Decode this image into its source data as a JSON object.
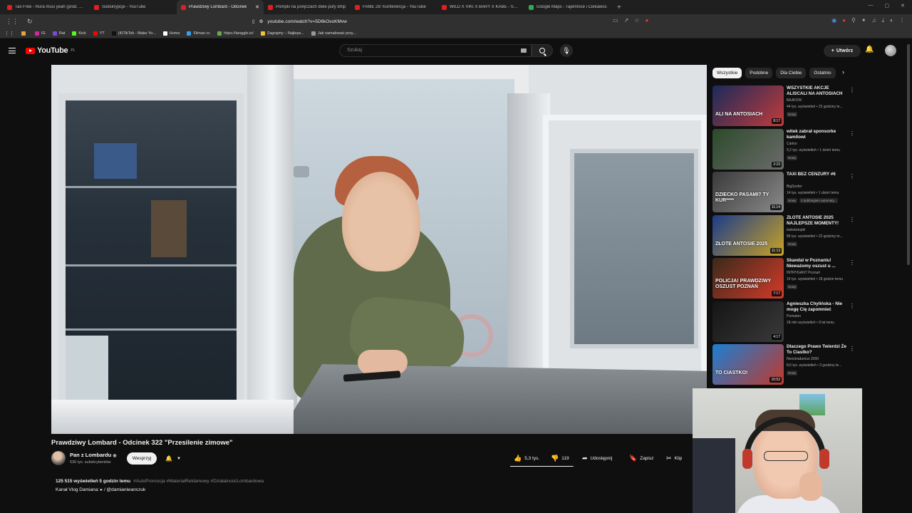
{
  "browser": {
    "tabs": [
      {
        "label": "Tax Free - Rura musi yeah (prod. CLO",
        "favicon": "youtube-favicon",
        "active": false
      },
      {
        "label": "Subskrypcje - YouTube",
        "favicon": "youtube-favicon",
        "active": false
      },
      {
        "label": "Prawdziwy Lombard - Odcinek",
        "favicon": "youtube-favicon",
        "active": true
      },
      {
        "label": "Pompki na poręczach dwie pufy dmp",
        "favicon": "youtube-favicon",
        "active": false
      },
      {
        "label": "FAME 29: Konferencja - YouTube",
        "favicon": "youtube-favicon",
        "active": false
      },
      {
        "label": "WILD X VIKI X BARY X KABE - SZLAG",
        "favicon": "youtube-favicon",
        "active": false
      },
      {
        "label": "Google Maps - Tajemnice i Ciekawos",
        "favicon": "maps-favicon",
        "active": false
      }
    ],
    "url": "youtube.com/watch?v=5D6kOvoKMvw",
    "bookmarks": [
      {
        "label": "",
        "color": "#e8a33a"
      },
      {
        "label": "IG",
        "color": "#d6249f"
      },
      {
        "label": "Rat",
        "color": "#7a4bd6"
      },
      {
        "label": "Kick",
        "color": "#53fc18"
      },
      {
        "label": "YT",
        "color": "#ff0000"
      },
      {
        "label": "(4)TikTok - Make Yo...",
        "color": "#111111"
      },
      {
        "label": "Home",
        "color": "#ffffff"
      },
      {
        "label": "Filman.cc",
        "color": "#3aa0e8"
      },
      {
        "label": "https://tanggle.io/",
        "color": "#6aa84f"
      },
      {
        "label": "Zagrajmy – Najleps...",
        "color": "#f1c232"
      },
      {
        "label": "Jak namalować przy...",
        "color": "#999999"
      }
    ]
  },
  "header": {
    "logo_text": "YouTube",
    "logo_country": "PL",
    "search_placeholder": "Szukaj",
    "create_label": "Utwórz"
  },
  "video": {
    "title": "Prawdziwy Lombard - Odcinek 322 \"Przesilenie zimowe\"",
    "channel_name": "Pan z Lombardu",
    "subscribers": "536 tys. subskrybentów",
    "support_label": "Wesprzyj",
    "likes": "5,3 tys.",
    "like_ratio": 0.979,
    "dislikes": "119",
    "share_label": "Udostępnij",
    "save_label": "Zapisz",
    "clip_label": "Klip",
    "views_line": "125 515 wyświetleń  5 godzin temu",
    "tags": "#AutoPromocja #MateriałReklamowy #DziałalnośćLombardowa",
    "desc_line2": "Kanał Vlog Damiana:  ▸ / @damianiwanczuk"
  },
  "sidebar": {
    "chips": [
      "Wszystkie",
      "Podobne",
      "Dla Ciebie",
      "Ostatnio"
    ],
    "active_chip": 0,
    "recommendations": [
      {
        "title": "WSZYSTKIE AKCJE ALISCALI NA ANTOSIACH",
        "channel": "BAJKOW",
        "meta": "44 tys. wyświetleń • 23 godziny te...",
        "badge": "Nowy",
        "duration": "8:17",
        "thumb_text": "ALI NA ANTOSIACH",
        "colors": [
          "#1a2a5a",
          "#c23b3b"
        ]
      },
      {
        "title": "witek zabrał sponsorke kamilowi",
        "channel": "Carloo",
        "meta": "9,2 tys. wyświetleń • 1 dzień temu",
        "badge": "Nowy",
        "duration": "2:23",
        "thumb_text": "",
        "colors": [
          "#2c4a2a",
          "#6b6b6b"
        ]
      },
      {
        "title": "TAXI BEZ CENZURY #6",
        "channel": "BigSzofer",
        "meta": "14 tys. wyświetleń • 1 dzień temu",
        "badge": "Nowy",
        "extra": "2 dubbingiem automaty...",
        "duration": "11:14",
        "thumb_text": "DZIECKO PASAMI? TY KUR****",
        "colors": [
          "#3a3a3a",
          "#8a8a8a"
        ]
      },
      {
        "title": "ZŁOTE ANTOSIE 2025 NAJLEPSZE MOMENTY!",
        "channel": "bokskstopik",
        "meta": "85 tys. wyświetleń • 22 godziny te...",
        "badge": "Nowy",
        "duration": "11:13",
        "thumb_text": "ZŁOTE ANTOSIE 2025",
        "colors": [
          "#1b3b8a",
          "#c9a227"
        ]
      },
      {
        "title": "Skandal w Poznaniu! Nieważomy oszust u ...",
        "channel": "INTRYGANT Poznań",
        "meta": "15 tys. wyświetleń • 18 godzin temu",
        "badge": "Nowy",
        "duration": "7:17",
        "thumb_text": "POLICJA! PRAWDZIWY OSZUST POZNAŃ",
        "colors": [
          "#3a2a1a",
          "#d43a2a"
        ]
      },
      {
        "title": "Agnieszka Chylińska - Nie mogę Cię zapomnieć",
        "channel": "Pomaton",
        "meta": "18 mln wyświetleń • 9 lat temu",
        "badge": "",
        "duration": "4:17",
        "thumb_text": "",
        "colors": [
          "#151515",
          "#3a3a3a"
        ]
      },
      {
        "title": "Dlaczego Prawo Twierdzi Że To Ciastko?",
        "channel": "Neostradamus 2000",
        "meta": "8,6 tys. wyświetleń • 3 godziny te...",
        "badge": "Nowy",
        "duration": "10:52",
        "thumb_text": "TO CIASTKO!",
        "colors": [
          "#1a7fd4",
          "#c0392b"
        ]
      }
    ]
  },
  "colors": {
    "brand_red": "#ff0000",
    "bg": "#0f0f0f",
    "chip_bg": "#272727"
  }
}
